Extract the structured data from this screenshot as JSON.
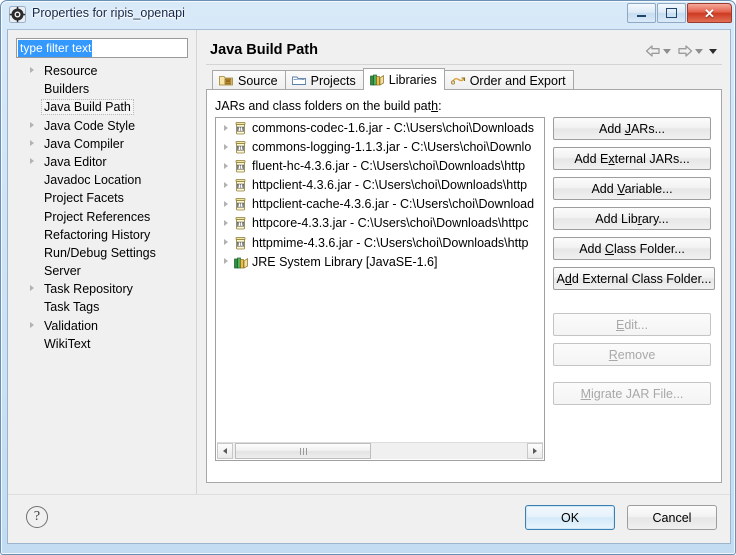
{
  "window": {
    "title": "Properties for ripis_openapi",
    "icon": "eclipse-properties-icon",
    "minimize_label": "Minimize",
    "maximize_label": "Maximize",
    "close_label": "Close"
  },
  "sidebar": {
    "filter": {
      "value": "type filter text",
      "placeholder": "type filter text",
      "selected": true
    },
    "items": [
      {
        "label": "Resource",
        "expandable": true,
        "selected": false
      },
      {
        "label": "Builders",
        "expandable": false,
        "selected": false
      },
      {
        "label": "Java Build Path",
        "expandable": false,
        "selected": true
      },
      {
        "label": "Java Code Style",
        "expandable": true,
        "selected": false
      },
      {
        "label": "Java Compiler",
        "expandable": true,
        "selected": false
      },
      {
        "label": "Java Editor",
        "expandable": true,
        "selected": false
      },
      {
        "label": "Javadoc Location",
        "expandable": false,
        "selected": false
      },
      {
        "label": "Project Facets",
        "expandable": false,
        "selected": false
      },
      {
        "label": "Project References",
        "expandable": false,
        "selected": false
      },
      {
        "label": "Refactoring History",
        "expandable": false,
        "selected": false
      },
      {
        "label": "Run/Debug Settings",
        "expandable": false,
        "selected": false
      },
      {
        "label": "Server",
        "expandable": false,
        "selected": false
      },
      {
        "label": "Task Repository",
        "expandable": true,
        "selected": false
      },
      {
        "label": "Task Tags",
        "expandable": false,
        "selected": false
      },
      {
        "label": "Validation",
        "expandable": true,
        "selected": false
      },
      {
        "label": "WikiText",
        "expandable": false,
        "selected": false
      }
    ]
  },
  "page": {
    "title": "Java Build Path",
    "nav": {
      "back_label": "Back",
      "back_enabled": false,
      "forward_label": "Forward",
      "forward_enabled": false,
      "menu_label": "View Menu"
    },
    "tabs": [
      {
        "label": "Source",
        "icon": "source-folder-icon",
        "active": false
      },
      {
        "label": "Projects",
        "icon": "projects-icon",
        "active": false
      },
      {
        "label": "Libraries",
        "icon": "libraries-book-icon",
        "active": true
      },
      {
        "label": "Order and Export",
        "icon": "order-export-icon",
        "active": false
      }
    ],
    "list_label": "JARs and class folders on the build path:",
    "list_label_mnemonic": "h",
    "entries": [
      {
        "name": "commons-codec-1.6.jar",
        "path": "C:\\Users\\choi\\Downloads",
        "icon": "jar-icon",
        "expandable": true
      },
      {
        "name": "commons-logging-1.1.3.jar",
        "path": "C:\\Users\\choi\\Downlo",
        "icon": "jar-icon",
        "expandable": true
      },
      {
        "name": "fluent-hc-4.3.6.jar",
        "path": "C:\\Users\\choi\\Downloads\\http",
        "icon": "jar-icon",
        "expandable": true
      },
      {
        "name": "httpclient-4.3.6.jar",
        "path": "C:\\Users\\choi\\Downloads\\http",
        "icon": "jar-icon",
        "expandable": true
      },
      {
        "name": "httpclient-cache-4.3.6.jar",
        "path": "C:\\Users\\choi\\Download",
        "icon": "jar-icon",
        "expandable": true
      },
      {
        "name": "httpcore-4.3.3.jar",
        "path": "C:\\Users\\choi\\Downloads\\httpc",
        "icon": "jar-icon",
        "expandable": true
      },
      {
        "name": "httpmime-4.3.6.jar",
        "path": "C:\\Users\\choi\\Downloads\\http",
        "icon": "jar-icon",
        "expandable": true
      },
      {
        "name": "JRE System Library [JavaSE-1.6]",
        "path": "",
        "icon": "library-book-icon",
        "expandable": true
      }
    ],
    "separator": " - ",
    "buttons": [
      {
        "label": "Add JARs...",
        "mnemonic": "J",
        "enabled": true,
        "wide": false
      },
      {
        "label": "Add External JARs...",
        "mnemonic": "x",
        "enabled": true,
        "wide": false
      },
      {
        "label": "Add Variable...",
        "mnemonic": "V",
        "enabled": true,
        "wide": false
      },
      {
        "label": "Add Library...",
        "mnemonic": "r",
        "enabled": true,
        "wide": false
      },
      {
        "label": "Add Class Folder...",
        "mnemonic": "C",
        "enabled": true,
        "wide": false
      },
      {
        "label": "Add External Class Folder...",
        "mnemonic": "d",
        "enabled": true,
        "wide": true
      },
      {
        "label": "Edit...",
        "mnemonic": "E",
        "enabled": false,
        "wide": false
      },
      {
        "label": "Remove",
        "mnemonic": "R",
        "enabled": false,
        "wide": false
      },
      {
        "label": "Migrate JAR File...",
        "mnemonic": "M",
        "enabled": false,
        "wide": false
      }
    ],
    "scrollbar": {
      "orientation": "horizontal",
      "left_arrow": "◀",
      "right_arrow": "▶"
    }
  },
  "footer": {
    "help_glyph": "?",
    "help_label": "Help",
    "ok_label": "OK",
    "cancel_label": "Cancel",
    "default_button": "OK"
  },
  "colors": {
    "title_gradient_top": "#d8e9f8",
    "title_gradient_bottom": "#c3dcf1",
    "selection_blue": "#3399ff",
    "close_red": "#cf3a22",
    "default_btn_border": "#3c7fb1",
    "panel_bg": "#f0f0f0"
  }
}
